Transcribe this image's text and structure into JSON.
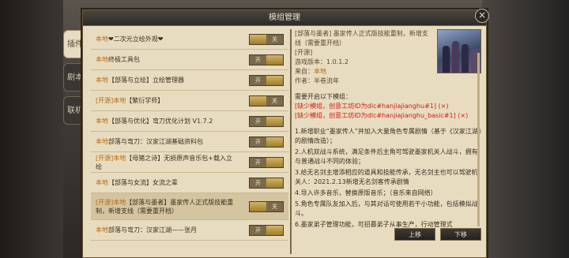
{
  "window": {
    "title": "模组管理",
    "close_icon": "×"
  },
  "side_tabs": [
    {
      "label": "插件",
      "active": true
    },
    {
      "label": "剧本",
      "active": false
    },
    {
      "label": "联机",
      "active": false
    }
  ],
  "toggle_labels": {
    "on": "开",
    "off": "关"
  },
  "mods": [
    {
      "prefix": "本地",
      "text": "❤二次元立绘外观❤",
      "state": "off"
    },
    {
      "prefix": "本地",
      "text": "终极工具包",
      "state": "on"
    },
    {
      "prefix": "本地",
      "text": "【部落与立绘】立绘管理器",
      "state": "on"
    },
    {
      "prefix": "[开源]本地",
      "text": "【繁衍学师】",
      "state": "off"
    },
    {
      "prefix": "本地",
      "text": "【部落与优化】弯刀优化计划 V1.7.2",
      "state": "on"
    },
    {
      "prefix": "本地",
      "text": "部落与弯刀：汉家江湖基础资料包",
      "state": "on"
    },
    {
      "prefix": "[开源]本地",
      "text": "【母猪之诗】无损原声音乐包+载入立绘",
      "state": "on"
    },
    {
      "prefix": "本地",
      "text": "【部落与女流】女流之辈",
      "state": "on"
    },
    {
      "prefix": "[开源]本地",
      "text": "【部落与墨者】墨家传人正式版技能重制，新增支线（需要重开档）",
      "state": "off",
      "selected": true
    },
    {
      "prefix": "本地",
      "text": "部落与弯刀：汉家江湖——张月",
      "state": "on"
    }
  ],
  "detail": {
    "title": "[部落与墨者] 墨家传人正式版技能重制，新增支线（需要重开档）",
    "open_tag": "[开源]",
    "version_label": "游戏版本：",
    "version": "1.0.1.2",
    "source_label": "来自：",
    "source": "本地",
    "author_label": "作者：",
    "author": "半卷流年",
    "requires_heading": "需要开启以下模组：",
    "missing": [
      "[缺少模组，创意工坊ID为dlc#hanjiajianghu#1] (×)",
      "[缺少模组，创意工坊ID为dlc#hanjiajianghu_basic#1] (×)"
    ],
    "body": [
      "1.新增职业“墨家传人”并加入大量角色专属剧情（基于《汉家江湖》的剧情改造）；",
      "2.人机双战斗系统，满足条件后主角可驾驶墨家机关人战斗，拥有与普通战斗不同的体验；",
      "3.给无名剑主增添相应的道具和技能传承，无名剑主也可以驾驶机关人：2021.2.13新增无名剑客传承剧情",
      "4.导入许多音乐，替换原版音乐；（音乐来自网络）",
      "5.角色专属队友加入后，与其对话可使用若干小功能，包括模拟战斗。",
      "6.墨家弟子管理功能，可招募弟子从事生产，行动管理式"
    ]
  },
  "buttons": {
    "up": "上移",
    "down": "下移"
  }
}
